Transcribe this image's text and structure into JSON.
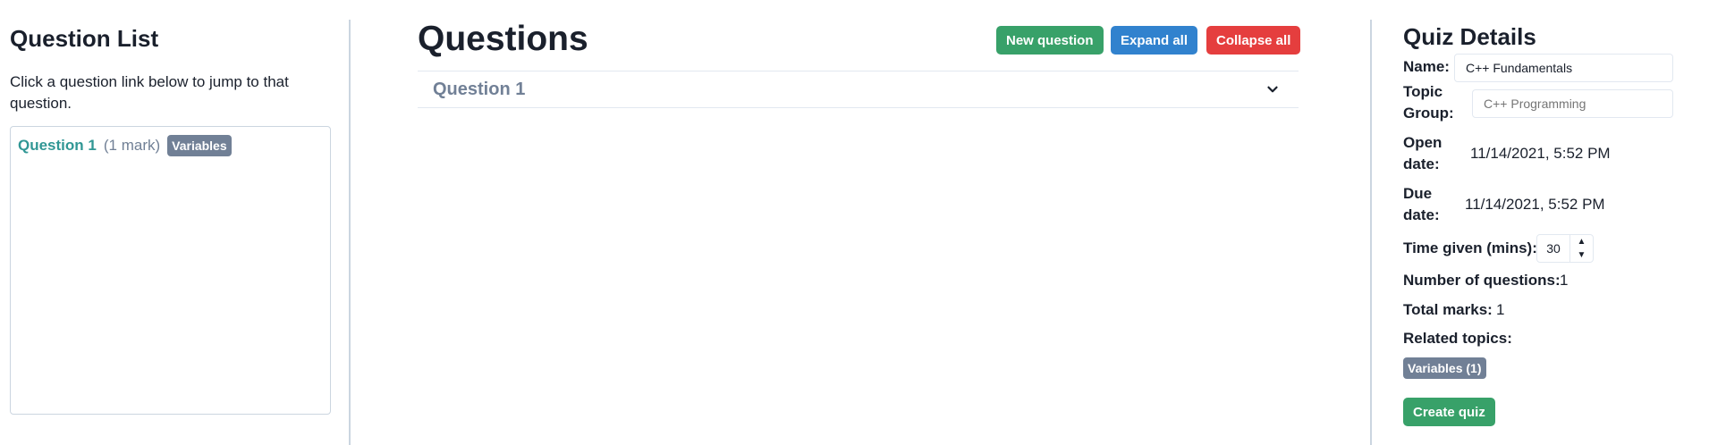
{
  "question_list": {
    "title": "Question List",
    "hint": "Click a question link below to jump to that question.",
    "items": [
      {
        "link": "Question 1",
        "marks": "(1 mark)",
        "topic": "Variables"
      }
    ]
  },
  "questions": {
    "title": "Questions",
    "new_label": "New question",
    "expand_label": "Expand all",
    "collapse_label": "Collapse all",
    "accordion": [
      {
        "title": "Question 1",
        "icon": "chevron-down-icon"
      }
    ]
  },
  "quiz_details": {
    "title": "Quiz Details",
    "name_label": "Name:",
    "name_value": "C++ Fundamentals",
    "topic_group_label": "Topic Group:",
    "topic_group_placeholder": "C++ Programming",
    "open_date_label": "Open date:",
    "open_date_value": "11/14/2021, 5:52 PM",
    "due_date_label": "Due date:",
    "due_date_value": "11/14/2021, 5:52 PM",
    "time_label": "Time given (mins):",
    "time_value": "30",
    "num_questions_label": "Number of questions:",
    "num_questions_value": "1",
    "total_marks_label": "Total marks:",
    "total_marks_value": "1",
    "related_topics_label": "Related topics:",
    "related_topics": [
      "Variables (1)"
    ],
    "create_label": "Create quiz"
  },
  "colors": {
    "green": "#38a169",
    "blue": "#3182ce",
    "red": "#e53e3e",
    "teal_link": "#319795",
    "badge_gray": "#718096",
    "divider": "#cbd5e0"
  }
}
